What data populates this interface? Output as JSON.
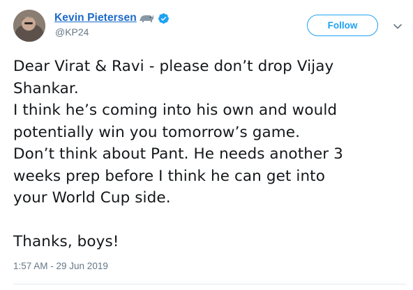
{
  "author": {
    "display_name": "Kevin Pietersen",
    "handle": "@KP24",
    "name_emoji_icon": "rhino-icon",
    "verified_icon": "verified-badge-icon",
    "link_color": "#1b6ac9"
  },
  "actions": {
    "follow_label": "Follow",
    "menu_icon": "chevron-down-icon",
    "accent_color": "#1da1f2"
  },
  "tweet": {
    "lines": [
      "Dear Virat & Ravi - please don’t drop Vijay",
      "Shankar.",
      "I think he’s coming into his own and would",
      "potentially win you tomorrow’s game.",
      "Don’t think about Pant. He needs another 3",
      "weeks prep before I think he can get into",
      "your World Cup side."
    ],
    "signoff": "Thanks, boys!",
    "timestamp": "1:57 AM - 29 Jun 2019"
  }
}
